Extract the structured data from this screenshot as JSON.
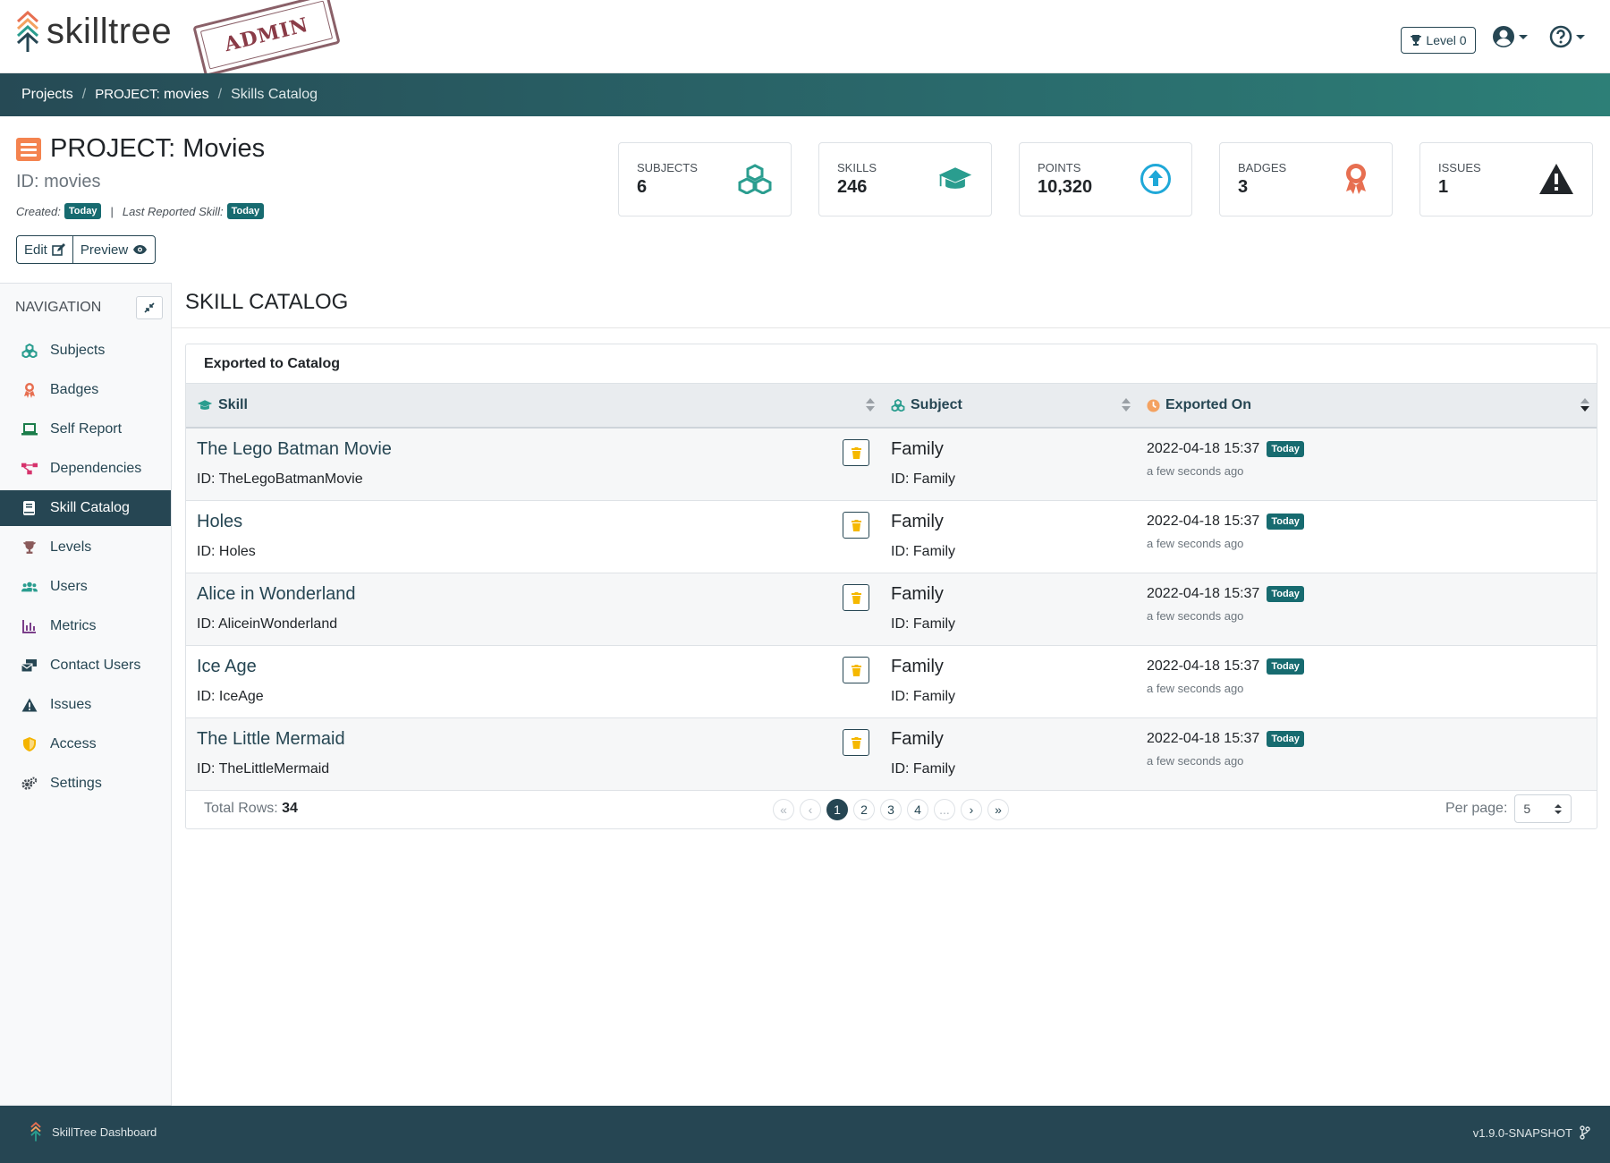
{
  "header": {
    "logo_text": "skilltree",
    "admin_stamp": "ADMIN",
    "level_label": "Level 0"
  },
  "breadcrumb": {
    "projects": "Projects",
    "project_prefix": "PROJECT:",
    "project_name": "movies",
    "current": "Skills Catalog"
  },
  "project": {
    "title": "PROJECT: Movies",
    "id_line": "ID: movies",
    "created_label": "Created:",
    "created_badge": "Today",
    "last_reported_label": "Last Reported Skill:",
    "last_reported_badge": "Today",
    "edit_label": "Edit",
    "preview_label": "Preview"
  },
  "stats": [
    {
      "label": "Subjects",
      "value": "6",
      "icon": "cubes-icon",
      "color": "#2a9d8f"
    },
    {
      "label": "Skills",
      "value": "246",
      "icon": "graduation-cap-icon",
      "color": "#2a9d8f"
    },
    {
      "label": "Points",
      "value": "10,320",
      "icon": "arrow-circle-up-icon",
      "color": "#1fa8d8"
    },
    {
      "label": "Badges",
      "value": "3",
      "icon": "award-icon",
      "color": "#e76f51"
    },
    {
      "label": "Issues",
      "value": "1",
      "icon": "warning-icon",
      "color": "#212529"
    }
  ],
  "sidebar": {
    "title": "Navigation",
    "items": [
      {
        "label": "Subjects",
        "icon": "cubes-icon"
      },
      {
        "label": "Badges",
        "icon": "award-icon"
      },
      {
        "label": "Self Report",
        "icon": "laptop-icon"
      },
      {
        "label": "Dependencies",
        "icon": "project-diagram-icon"
      },
      {
        "label": "Skill Catalog",
        "icon": "book-icon"
      },
      {
        "label": "Levels",
        "icon": "trophy-icon"
      },
      {
        "label": "Users",
        "icon": "users-icon"
      },
      {
        "label": "Metrics",
        "icon": "chart-icon"
      },
      {
        "label": "Contact Users",
        "icon": "mail-bulk-icon"
      },
      {
        "label": "Issues",
        "icon": "warning-icon"
      },
      {
        "label": "Access",
        "icon": "shield-icon"
      },
      {
        "label": "Settings",
        "icon": "cogs-icon"
      }
    ]
  },
  "main": {
    "title": "Skill Catalog",
    "card_title": "Exported to Catalog",
    "columns": [
      "Skill",
      "Subject",
      "Exported On"
    ],
    "rows": [
      {
        "skill": "The Lego Batman Movie",
        "skill_id": "ID: TheLegoBatmanMovie",
        "subject": "Family",
        "subject_id": "ID: Family",
        "exported": "2022-04-18 15:37",
        "badge": "Today",
        "ago": "a few seconds ago"
      },
      {
        "skill": "Holes",
        "skill_id": "ID: Holes",
        "subject": "Family",
        "subject_id": "ID: Family",
        "exported": "2022-04-18 15:37",
        "badge": "Today",
        "ago": "a few seconds ago"
      },
      {
        "skill": "Alice in Wonderland",
        "skill_id": "ID: AliceinWonderland",
        "subject": "Family",
        "subject_id": "ID: Family",
        "exported": "2022-04-18 15:37",
        "badge": "Today",
        "ago": "a few seconds ago"
      },
      {
        "skill": "Ice Age",
        "skill_id": "ID: IceAge",
        "subject": "Family",
        "subject_id": "ID: Family",
        "exported": "2022-04-18 15:37",
        "badge": "Today",
        "ago": "a few seconds ago"
      },
      {
        "skill": "The Little Mermaid",
        "skill_id": "ID: TheLittleMermaid",
        "subject": "Family",
        "subject_id": "ID: Family",
        "exported": "2022-04-18 15:37",
        "badge": "Today",
        "ago": "a few seconds ago"
      }
    ],
    "total_label": "Total Rows:",
    "total_value": "34",
    "pager": [
      "«",
      "‹",
      "1",
      "2",
      "3",
      "4",
      "...",
      "›",
      "»"
    ],
    "per_page_label": "Per page:",
    "per_page_value": "5"
  },
  "footer": {
    "app_name": "SkillTree Dashboard",
    "version": "v1.9.0-SNAPSHOT"
  },
  "colors": {
    "primary": "#264653",
    "accent": "#2a9d8f",
    "badge_today": "#176b70",
    "delete_icon": "#f5b800"
  }
}
